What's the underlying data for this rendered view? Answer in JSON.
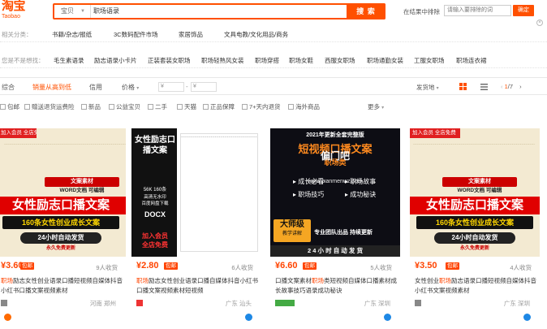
{
  "header": {
    "logo_cn": "淘宝",
    "logo_en": "Taobao",
    "search_category": "宝贝",
    "search_value": "职场语录",
    "search_button": "搜 索",
    "exclude_label": "在结果中排除",
    "exclude_placeholder": "请输入要排除的词",
    "exclude_button": "确定"
  },
  "filters": {
    "row1_label": "相关分类：",
    "row1_options": [
      "书籍/杂志/报纸",
      "3C数码配件市场",
      "家居饰品",
      "文具电教/文化用品/商务"
    ],
    "row2_label": "您是不是想找：",
    "row2_options": [
      "毛生素语录",
      "励志语录小卡片",
      "正装套装女职场",
      "职场轻熟风女装",
      "职场穿搭",
      "职场女鞋",
      "西服女职场",
      "职场通勤女装",
      "工服女职场",
      "职场连衣裙"
    ]
  },
  "sortbar": {
    "items": [
      "综合",
      "销量从高到低",
      "信用",
      "价格"
    ],
    "price_from": "¥",
    "price_to": "¥",
    "ship_select": "发货地",
    "page_current": "1",
    "page_total": "/7"
  },
  "checkboxes": [
    "包邮",
    "赠送退货运费险",
    "新品",
    "公益宝贝",
    "二手",
    "天猫",
    "正品保障",
    "7+天内退货",
    "海外商品"
  ],
  "more_label": "更多",
  "products": [
    {
      "banner_top": "加入会员 全店免费",
      "banner_red": "文案素材",
      "banner_word": "WORD文档 可编辑",
      "main_title": "女性励志口播文案",
      "subtitle": "160条女性创业成长文案",
      "footer": "24小时自动发货",
      "footer2": "永久免费更新",
      "price": "¥3.60",
      "bao": "包邮",
      "paid": "9人收货",
      "title_pre": "",
      "title_hl": "职场",
      "title_post": "励志女性创业语录口播短视频自媒体抖音小红书口播文案视频素材",
      "location": "河南 郑州"
    },
    {
      "main_title": "女性励志口播文案",
      "spec1": "56K  160条",
      "spec2": "高清无水印",
      "spec3": "百度网盘下载",
      "format": "DOCX",
      "member1": "加入会员",
      "member2": "全店免费",
      "price": "¥2.80",
      "bao": "包邮",
      "paid": "6人收货",
      "title_pre": "",
      "title_hl": "职场",
      "title_post": "励志女性创业语录口播自媒体抖音小红书口播文案视频素材短视频",
      "location": "广东 汕头"
    },
    {
      "year_line": "2021年更新全套完整版",
      "main_title": "短视频口播文案",
      "main_sub": "职场类",
      "kw1": "成长必看",
      "kw2": "职场故事",
      "kw3": "职场技巧",
      "kw4": "成功秘诀",
      "badge1": "大师级",
      "badge2": "教学讲解",
      "side_text": "专业团队出品  持续更新",
      "bottom": "2 4 小 时 自 动 发 货",
      "watermark1": "偏门吧",
      "watermark2": "www.pianmenwz.com",
      "price": "¥6.60",
      "bao": "包邮",
      "paid": "5人收货",
      "title_pre": "口播文案素材",
      "title_hl": "职场",
      "title_post": "类短视频自媒体口播素材成长故事技巧语录成功秘诀",
      "location": "广东 深圳"
    },
    {
      "banner_top": "加入会员 全店免费",
      "banner_red": "文案素材",
      "banner_word": "WORD文档 可编辑",
      "main_title": "女性励志口播文案",
      "subtitle": "160条女性创业成长文案",
      "footer": "24小时自动发货",
      "footer2": "永久免费更新",
      "price": "¥3.50",
      "bao": "包邮",
      "paid": "4人收货",
      "title_pre": "女性创业",
      "title_hl": "职场",
      "title_post": "励志语录口播短视频自媒体抖音小红书文案视频素材",
      "location": "广东 深圳"
    }
  ]
}
